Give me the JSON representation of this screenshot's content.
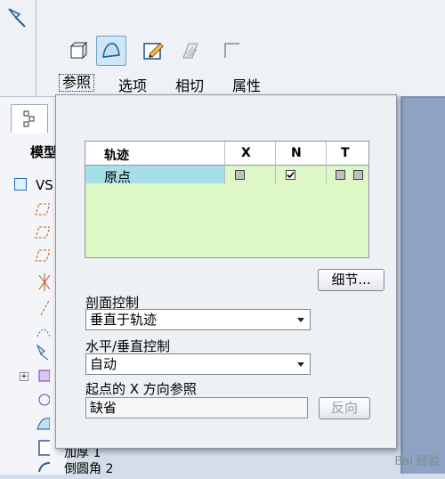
{
  "toolbar": {
    "menus": [
      "参照",
      "选项",
      "相切",
      "属性"
    ],
    "active_menu": "参照"
  },
  "tree": {
    "header": "模型",
    "root_label": "VS",
    "bottom_items": [
      "加厚 1",
      "倒圆角 2"
    ]
  },
  "popup": {
    "trajectory_table": {
      "headers": [
        "轨迹",
        "X",
        "N",
        "T"
      ],
      "rows": [
        {
          "name": "原点",
          "x": "unchecked",
          "n": "checked",
          "t": "unchecked"
        }
      ]
    },
    "details_button": "细节...",
    "section_control": {
      "label": "剖面控制",
      "value": "垂直于轨迹"
    },
    "hv_control": {
      "label": "水平/垂直控制",
      "value": "自动"
    },
    "x_ref": {
      "label": "起点的 X 方向参照",
      "value": "缺省"
    },
    "reverse_button": "反向"
  },
  "watermark": "Bai 经验",
  "colors": {
    "accent": "#6aa3cc",
    "table_bg": "#ddf8c6",
    "selected_row": "#a7dfe8"
  }
}
